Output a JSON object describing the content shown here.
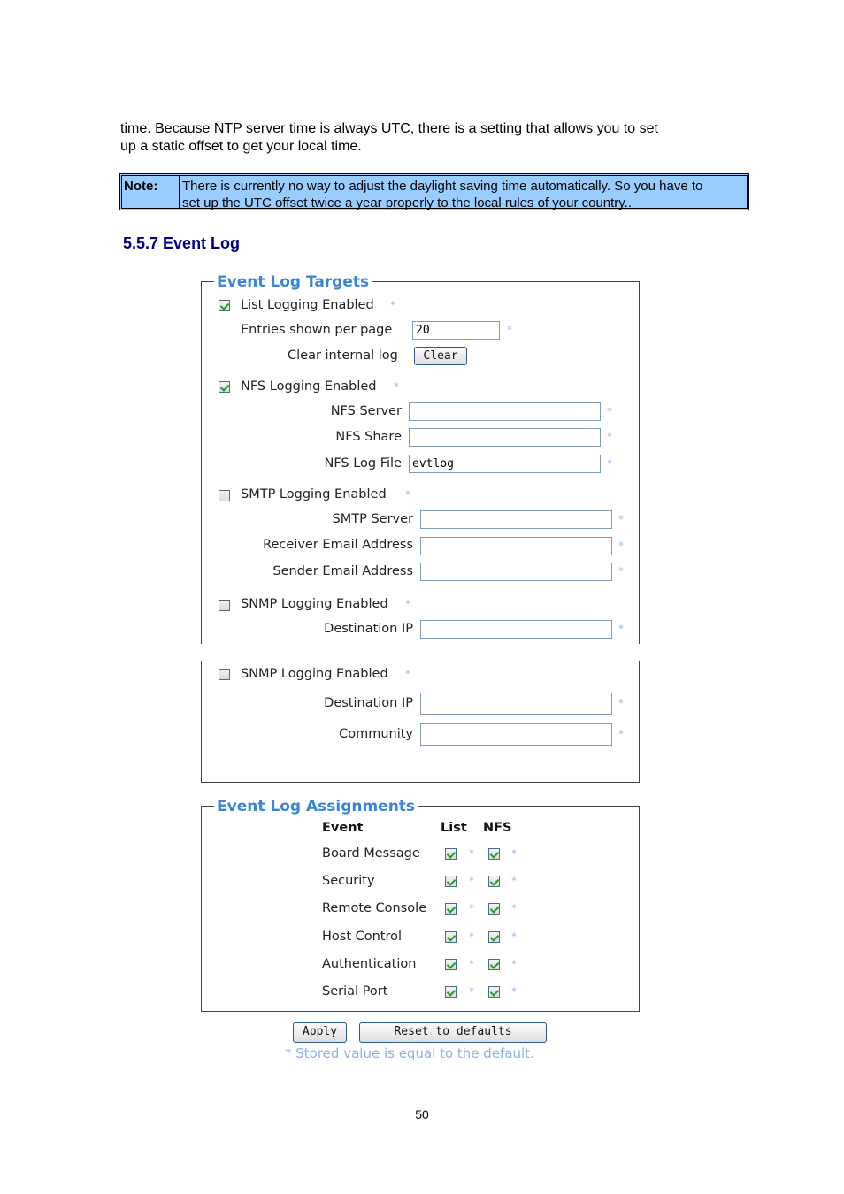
{
  "intro": {
    "line1": "time. Because NTP server time is always UTC, there is a setting that allows you to set",
    "line2": "up a static offset to get your local time."
  },
  "note": {
    "label": "Note:",
    "line1": "There is currently no way to adjust the daylight saving time automatically. So you have to",
    "line2": "set up the UTC offset twice a year properly to the local rules of your country.."
  },
  "section_heading": "5.5.7 Event Log",
  "targets": {
    "legend": "Event Log Targets",
    "list_logging": {
      "label": "List Logging Enabled",
      "checked": true
    },
    "entries_per_page": {
      "label": "Entries shown per page",
      "value": "20"
    },
    "clear_log": {
      "label": "Clear internal log",
      "button": "Clear"
    },
    "nfs_logging": {
      "label": "NFS Logging Enabled",
      "checked": true
    },
    "nfs_server": {
      "label": "NFS Server",
      "value": ""
    },
    "nfs_share": {
      "label": "NFS Share",
      "value": ""
    },
    "nfs_log_file": {
      "label": "NFS Log File",
      "value": "evtlog"
    },
    "smtp_logging": {
      "label": "SMTP Logging Enabled",
      "checked": false
    },
    "smtp_server": {
      "label": "SMTP Server",
      "value": ""
    },
    "receiver_email": {
      "label": "Receiver Email Address",
      "value": ""
    },
    "sender_email": {
      "label": "Sender Email Address",
      "value": ""
    },
    "snmp_logging": {
      "label": "SNMP Logging Enabled",
      "checked": false
    },
    "destination_ip": {
      "label": "Destination IP",
      "value": ""
    }
  },
  "snmp_continued": {
    "snmp_logging": {
      "label": "SNMP Logging Enabled",
      "checked": false
    },
    "destination_ip": {
      "label": "Destination IP",
      "value": ""
    },
    "community": {
      "label": "Community",
      "value": ""
    }
  },
  "assignments": {
    "legend": "Event Log Assignments",
    "headers": {
      "event": "Event",
      "list": "List",
      "nfs": "NFS"
    },
    "rows": [
      {
        "event": "Board Message",
        "list": true,
        "nfs": true
      },
      {
        "event": "Security",
        "list": true,
        "nfs": true
      },
      {
        "event": "Remote Console",
        "list": true,
        "nfs": true
      },
      {
        "event": "Host Control",
        "list": true,
        "nfs": true
      },
      {
        "event": "Authentication",
        "list": true,
        "nfs": true
      },
      {
        "event": "Serial Port",
        "list": true,
        "nfs": true
      }
    ]
  },
  "actions": {
    "apply": "Apply",
    "reset": "Reset to defaults"
  },
  "default_star": "*",
  "footnote": "* Stored value is equal to the default.",
  "page_number": "50"
}
